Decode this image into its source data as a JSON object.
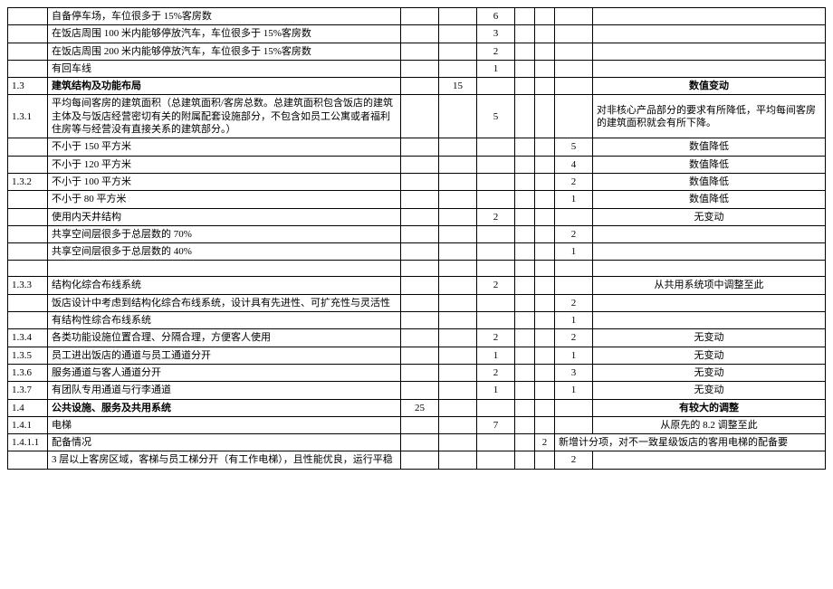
{
  "rows": [
    {
      "id": "",
      "desc": "自备停车场，车位很多于 15%客房数",
      "n1": "",
      "n2": "",
      "n3": "6",
      "n4": "",
      "note": ""
    },
    {
      "id": "",
      "desc": "在饭店周围 100 米内能够停放汽车，车位很多于 15%客房数",
      "n1": "",
      "n2": "",
      "n3": "3",
      "n4": "",
      "note": ""
    },
    {
      "id": "",
      "desc": "在饭店周围 200 米内能够停放汽车，车位很多于 15%客房数",
      "n1": "",
      "n2": "",
      "n3": "2",
      "n4": "",
      "note": ""
    },
    {
      "id": "",
      "desc": "有回车线",
      "n1": "",
      "n2": "",
      "n3": "1",
      "n4": "",
      "note": ""
    },
    {
      "id": "1.3",
      "desc": "建筑结构及功能布局",
      "n1": "",
      "n2": "15",
      "n3": "",
      "n4": "",
      "note": "数值变动",
      "bold": true,
      "noteBold": true
    },
    {
      "id": "1.3.1",
      "desc": "平均每间客房的建筑面积（总建筑面积/客房总数。总建筑面积包含饭店的建筑主体及与饭店经营密切有关的附属配套设施部分，不包含如员工公寓或者福利住房等与经营没有直接关系的建筑部分。）",
      "n1": "",
      "n2": "",
      "n3": "5",
      "n4": "",
      "note": "对非核心产品部分的要求有所降低，平均每间客房的建筑面积就会有所下降。",
      "noteLeft": true
    },
    {
      "id": "",
      "desc": "不小于 150 平方米",
      "n1": "",
      "n2": "",
      "n3": "",
      "n4": "5",
      "note": "数值降低"
    },
    {
      "id": "",
      "desc": "不小于 120 平方米",
      "n1": "",
      "n2": "",
      "n3": "",
      "n4": "4",
      "note": "数值降低"
    },
    {
      "id": "1.3.2",
      "desc": "不小于 100 平方米",
      "n1": "",
      "n2": "",
      "n3": "",
      "n4": "2",
      "note": "数值降低"
    },
    {
      "id": "",
      "desc": "不小于 80 平方米",
      "n1": "",
      "n2": "",
      "n3": "",
      "n4": "1",
      "note": "数值降低"
    },
    {
      "id": "",
      "desc": "使用内天井结构",
      "n1": "",
      "n2": "",
      "n3": "2",
      "n4": "",
      "note": "无变动"
    },
    {
      "id": "",
      "desc": "共享空间层很多于总层数的 70%",
      "n1": "",
      "n2": "",
      "n3": "",
      "n4": "2",
      "note": ""
    },
    {
      "id": "",
      "desc": "共享空间层很多于总层数的 40%",
      "n1": "",
      "n2": "",
      "n3": "",
      "n4": "1",
      "note": ""
    },
    {
      "id": "",
      "desc": "",
      "n1": "",
      "n2": "",
      "n3": "",
      "n4": "",
      "note": ""
    },
    {
      "id": "1.3.3",
      "desc": "结构化综合布线系统",
      "n1": "",
      "n2": "",
      "n3": "2",
      "n4": "",
      "note": "从共用系统项中调整至此"
    },
    {
      "id": "",
      "desc": "饭店设计中考虑到结构化综合布线系统，设计具有先进性、可扩充性与灵活性",
      "n1": "",
      "n2": "",
      "n3": "",
      "n4": "2",
      "note": ""
    },
    {
      "id": "",
      "desc": "有结构性综合布线系统",
      "n1": "",
      "n2": "",
      "n3": "",
      "n4": "1",
      "note": ""
    },
    {
      "id": "1.3.4",
      "desc": "各类功能设施位置合理、分隔合理，方便客人使用",
      "n1": "",
      "n2": "",
      "n3": "2",
      "n4": "2",
      "note": "无变动"
    },
    {
      "id": "1.3.5",
      "desc": "员工进出饭店的通道与员工通道分开",
      "n1": "",
      "n2": "",
      "n3": "1",
      "n4": "1",
      "note": "无变动"
    },
    {
      "id": "1.3.6",
      "desc": "服务通道与客人通道分开",
      "n1": "",
      "n2": "",
      "n3": "2",
      "n4": "3",
      "note": "无变动"
    },
    {
      "id": "1.3.7",
      "desc": "有团队专用通道与行李通道",
      "n1": "",
      "n2": "",
      "n3": "1",
      "n4": "1",
      "note": "无变动"
    },
    {
      "id": "1.4",
      "desc": "公共设施、服务及共用系统",
      "n1": "25",
      "n2": "",
      "n3": "",
      "n4": "",
      "note": "有较大的调整",
      "bold": true,
      "noteBold": true
    },
    {
      "id": "1.4.1",
      "desc": "电梯",
      "n1": "",
      "n2": "",
      "n3": "7",
      "n4": "",
      "note": "从原先的 8.2 调整至此"
    },
    {
      "id": "1.4.1.1",
      "desc": "配备情况",
      "n1": "",
      "n2": "",
      "n3": "",
      "n4": "2",
      "note": "新增计分项，对不一致星级饭店的客用电梯的配备要",
      "noteLeft": true,
      "c4col7": true
    },
    {
      "id": "",
      "desc": "3 层以上客房区域，客梯与员工梯分开（有工作电梯），且性能优良，运行平稳",
      "n1": "",
      "n2": "",
      "n3": "",
      "n4": "2",
      "note": "",
      "noteNoLeft": true,
      "c4col8": true
    }
  ]
}
